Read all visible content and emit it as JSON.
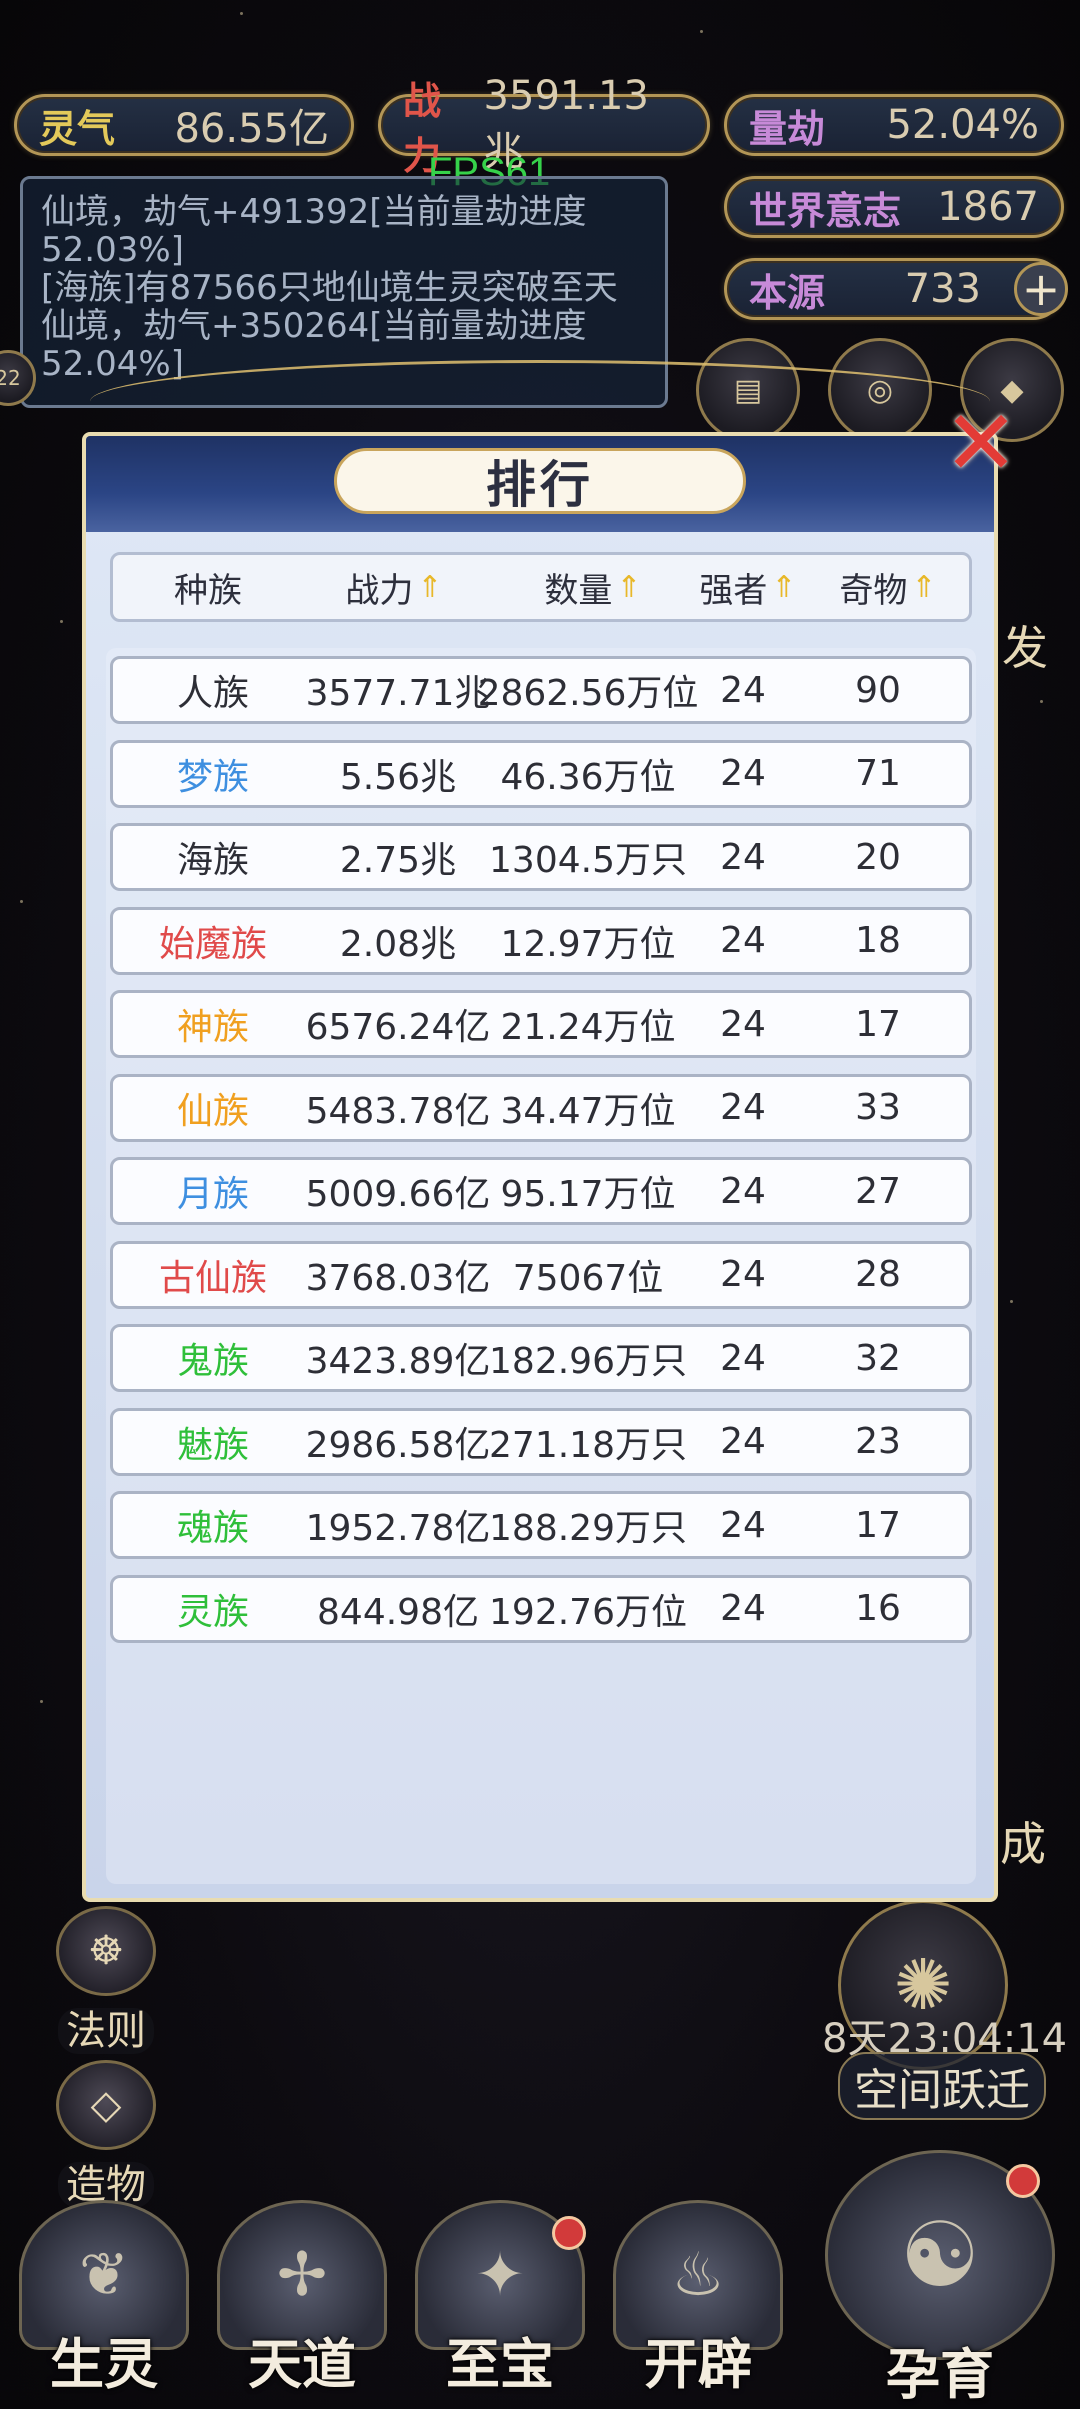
{
  "hud": {
    "lingqi": {
      "label": "灵气",
      "value": "86.55亿"
    },
    "zhanli": {
      "label": "战力",
      "value": "3591.13兆"
    },
    "liangjie": {
      "label": "量劫",
      "value": "52.04%"
    },
    "shijie": {
      "label": "世界意志",
      "value": "1867"
    },
    "benyuan": {
      "label": "本源",
      "value": "733"
    },
    "fps": "FPS61",
    "left_badge": "22"
  },
  "log": {
    "lines": [
      {
        "text": "仙境，劫气+491392[当前量劫进度"
      },
      {
        "text": "52.03%]"
      },
      {
        "text": "[海族]有87566只地仙境生灵突破至天"
      },
      {
        "text": "仙境，劫气+350264[当前量劫进度"
      },
      {
        "text": "52.04%]"
      }
    ]
  },
  "side": {
    "left": [
      {
        "label": "法则"
      },
      {
        "label": "造物"
      }
    ],
    "right_partial": {
      "top": "发",
      "bottom": "成"
    }
  },
  "timer": "8天23:04:14",
  "space_jump": "空间跃迁",
  "nav": [
    {
      "label": "生灵"
    },
    {
      "label": "天道"
    },
    {
      "label": "至宝"
    },
    {
      "label": "开辟"
    },
    {
      "label": "孕育"
    }
  ],
  "modal": {
    "title": "排行",
    "columns": [
      "种族",
      "战力",
      "数量",
      "强者",
      "奇物"
    ],
    "rows": [
      {
        "race": "人族",
        "power": "3577.71兆",
        "count": "2862.56万位",
        "strong": "24",
        "artifact": "90",
        "color": "#2d2e36"
      },
      {
        "race": "梦族",
        "power": "5.56兆",
        "count": "46.36万位",
        "strong": "24",
        "artifact": "71",
        "color": "#3e8fe0"
      },
      {
        "race": "海族",
        "power": "2.75兆",
        "count": "1304.5万只",
        "strong": "24",
        "artifact": "20",
        "color": "#2d2e36"
      },
      {
        "race": "始魔族",
        "power": "2.08兆",
        "count": "12.97万位",
        "strong": "24",
        "artifact": "18",
        "color": "#e04a4a"
      },
      {
        "race": "神族",
        "power": "6576.24亿",
        "count": "21.24万位",
        "strong": "24",
        "artifact": "17",
        "color": "#f0a020"
      },
      {
        "race": "仙族",
        "power": "5483.78亿",
        "count": "34.47万位",
        "strong": "24",
        "artifact": "33",
        "color": "#f0a020"
      },
      {
        "race": "月族",
        "power": "5009.66亿",
        "count": "95.17万位",
        "strong": "24",
        "artifact": "27",
        "color": "#3e8fe0"
      },
      {
        "race": "古仙族",
        "power": "3768.03亿",
        "count": "75067位",
        "strong": "24",
        "artifact": "28",
        "color": "#e04a4a"
      },
      {
        "race": "鬼族",
        "power": "3423.89亿",
        "count": "182.96万只",
        "strong": "24",
        "artifact": "32",
        "color": "#2fbf3a"
      },
      {
        "race": "魅族",
        "power": "2986.58亿",
        "count": "271.18万只",
        "strong": "24",
        "artifact": "23",
        "color": "#2fbf3a"
      },
      {
        "race": "魂族",
        "power": "1952.78亿",
        "count": "188.29万只",
        "strong": "24",
        "artifact": "17",
        "color": "#2fbf3a"
      },
      {
        "race": "灵族",
        "power": "844.98亿",
        "count": "192.76万位",
        "strong": "24",
        "artifact": "16",
        "color": "#2fbf3a"
      }
    ]
  },
  "colors": {
    "accent_gold": "#b39656",
    "close_red": "#e33b36",
    "sort_arrow": "#e8b82a"
  }
}
